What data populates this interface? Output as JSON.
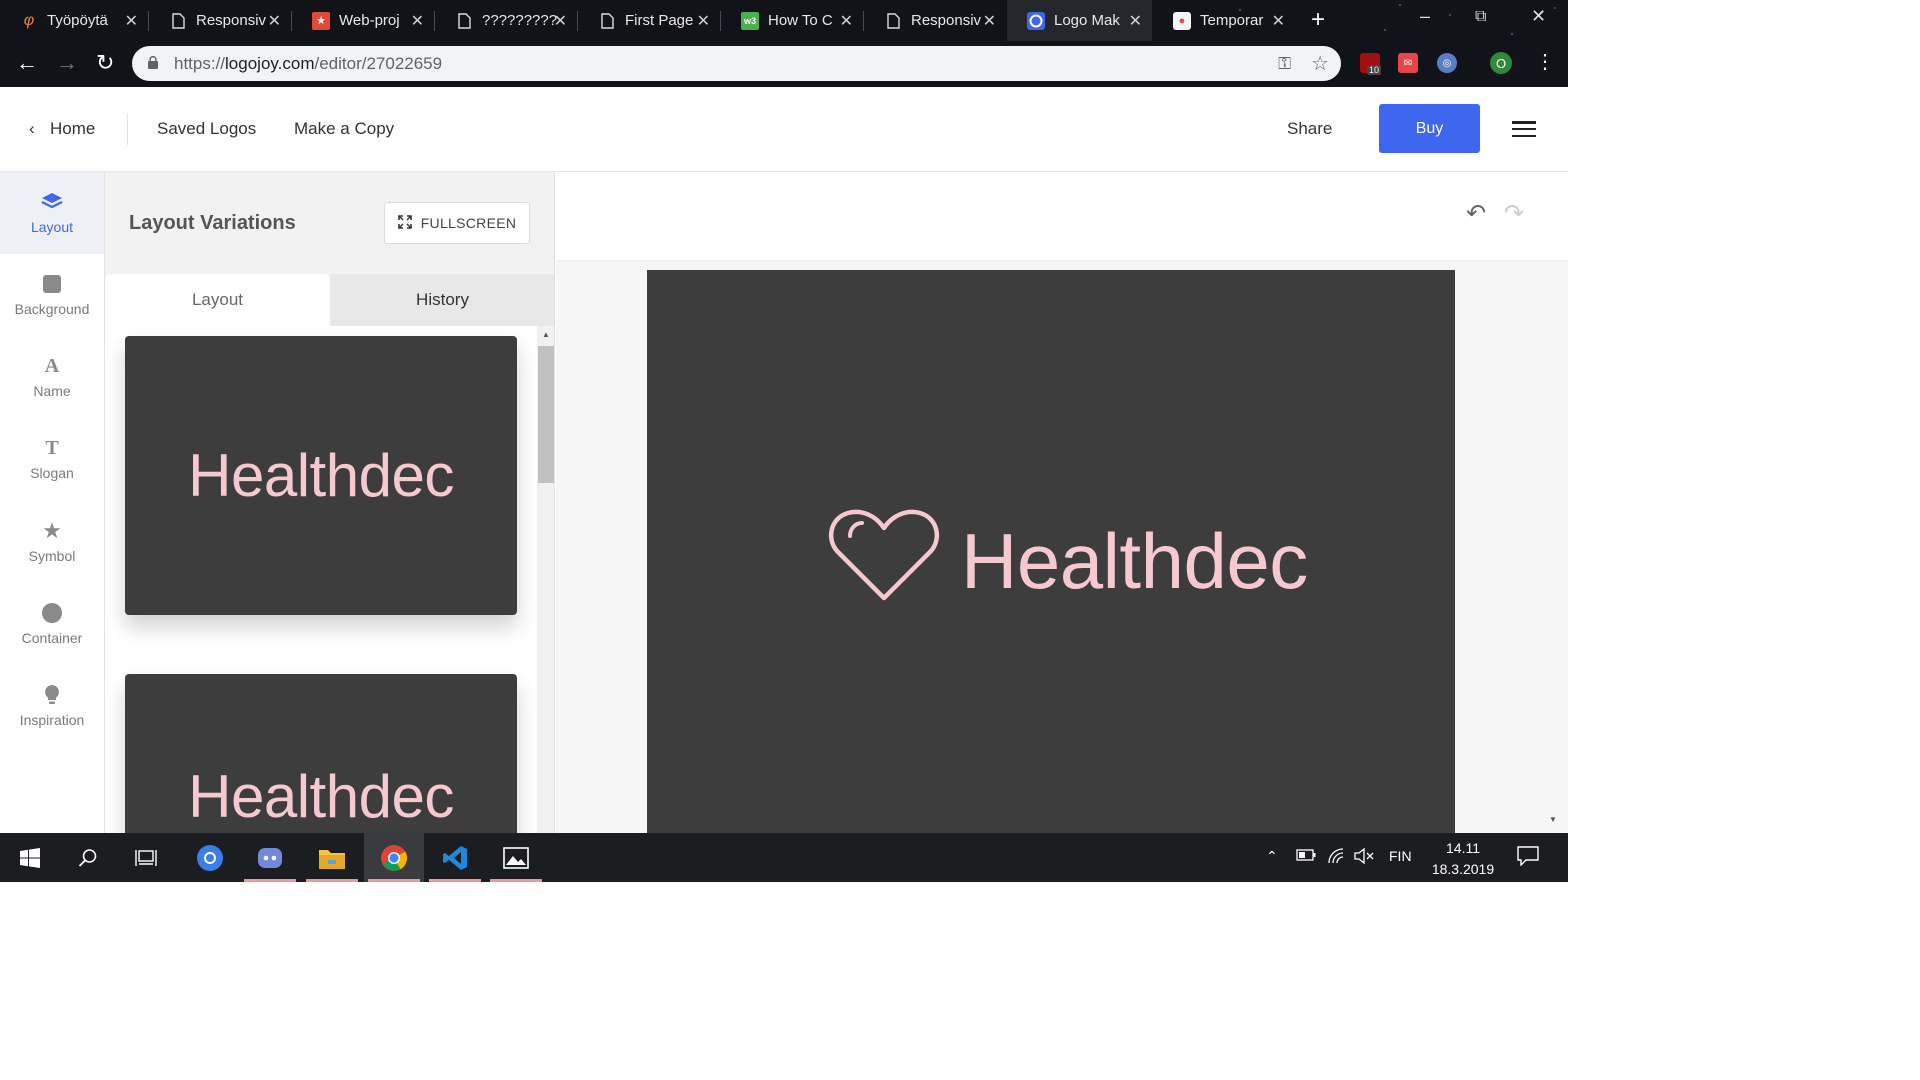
{
  "browser": {
    "tabs": [
      {
        "title": "Työpöytä",
        "favicon": "lightning-icon"
      },
      {
        "title": "Responsiv",
        "favicon": "page-icon"
      },
      {
        "title": "Web-proj",
        "favicon": "red-star-icon"
      },
      {
        "title": "?????????",
        "favicon": "page-icon"
      },
      {
        "title": "First Page",
        "favicon": "page-icon"
      },
      {
        "title": "How To C",
        "favicon": "w3-icon"
      },
      {
        "title": "Responsiv",
        "favicon": "page-icon"
      },
      {
        "title": "Logo Mak",
        "favicon": "logojoy-icon",
        "active": true
      },
      {
        "title": "Temporar",
        "favicon": "mascot-icon"
      }
    ],
    "url_prefix": "https://",
    "url_domain": "logojoy.com",
    "url_path": "/editor/27022659",
    "extensions": [
      {
        "name": "ublock-icon",
        "badge": "10"
      },
      {
        "name": "mail-extension-icon"
      },
      {
        "name": "search-extension-icon"
      },
      {
        "name": "profile-avatar",
        "label": "O"
      }
    ]
  },
  "header": {
    "home": "Home",
    "saved_logos": "Saved Logos",
    "make_copy": "Make a Copy",
    "share": "Share",
    "buy": "Buy"
  },
  "rail": [
    {
      "label": "Layout",
      "icon": "layers-icon",
      "active": true
    },
    {
      "label": "Background",
      "icon": "square-icon"
    },
    {
      "label": "Name",
      "icon": "letter-a-icon"
    },
    {
      "label": "Slogan",
      "icon": "letter-t-icon"
    },
    {
      "label": "Symbol",
      "icon": "star-icon"
    },
    {
      "label": "Container",
      "icon": "circle-icon"
    },
    {
      "label": "Inspiration",
      "icon": "lightbulb-icon"
    }
  ],
  "panel": {
    "title": "Layout Variations",
    "fullscreen": "FULLSCREEN",
    "tabs": [
      "Layout",
      "History"
    ],
    "variations": [
      "Healthdec",
      "Healthdec"
    ]
  },
  "logo": {
    "name": "Healthdec",
    "symbol": "heart-icon",
    "background_color": "#3d3d3d",
    "text_color": "#f6c9d1"
  },
  "taskbar": {
    "apps": [
      "start-icon",
      "search-icon",
      "task-view-icon",
      "chromium-icon",
      "discord-icon",
      "file-explorer-icon",
      "chrome-icon",
      "vscode-icon",
      "photos-icon"
    ],
    "language": "FIN",
    "time": "14.11",
    "date": "18.3.2019"
  },
  "colors": {
    "accent": "#3f66ee",
    "logo_pink": "#f6c9d1"
  }
}
